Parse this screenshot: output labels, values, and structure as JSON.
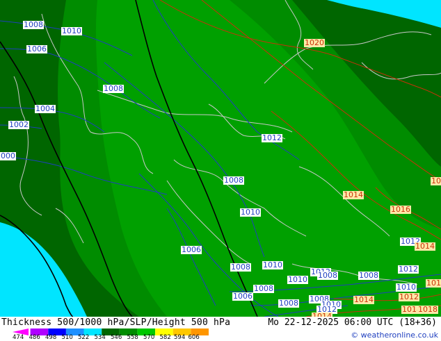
{
  "footer": {
    "title": "Thickness 500/1000 hPa/SLP/Height 500 hPa",
    "datetime": "Mo 22-12-2025 06:00 UTC (18+36)",
    "copyright": "© weatheronline.co.uk"
  },
  "scale": {
    "ticks": [
      "474",
      "486",
      "498",
      "510",
      "522",
      "534",
      "546",
      "558",
      "570",
      "582",
      "594",
      "606"
    ],
    "colors": [
      "#ff00ff",
      "#b000ff",
      "#0000ff",
      "#1e90ff",
      "#00e5ff",
      "#006600",
      "#008c00",
      "#00c800",
      "#ffff00",
      "#ffc800",
      "#ff9600"
    ]
  },
  "colors": {
    "thickness_cyan": "#00e5ff",
    "thickness_dark": "#006600",
    "thickness_mid": "#008c00",
    "thickness_light": "#00a000",
    "isobar_low": "#1f3fbf",
    "isobar_high": "#c8320a",
    "height_500": "#000000",
    "coastline": "#bfbfbf"
  },
  "isobar_labels": [
    {
      "text": "1008",
      "color": "blue"
    },
    {
      "text": "1010",
      "color": "blue"
    },
    {
      "text": "1006",
      "color": "blue"
    },
    {
      "text": "1008",
      "color": "blue"
    },
    {
      "text": "1004",
      "color": "blue"
    },
    {
      "text": "1002",
      "color": "blue"
    },
    {
      "text": "000",
      "color": "blue"
    },
    {
      "text": "1012",
      "color": "blue"
    },
    {
      "text": "1008",
      "color": "blue"
    },
    {
      "text": "1010",
      "color": "blue"
    },
    {
      "text": "1006",
      "color": "blue"
    },
    {
      "text": "1008",
      "color": "blue"
    },
    {
      "text": "1010",
      "color": "blue"
    },
    {
      "text": "1012",
      "color": "blue"
    },
    {
      "text": "1008",
      "color": "blue"
    },
    {
      "text": "1006",
      "color": "blue"
    },
    {
      "text": "1008",
      "color": "blue"
    },
    {
      "text": "1010",
      "color": "blue"
    },
    {
      "text": "1008",
      "color": "blue"
    },
    {
      "text": "1008",
      "color": "blue"
    },
    {
      "text": "1008",
      "color": "blue"
    },
    {
      "text": "1010",
      "color": "blue"
    },
    {
      "text": "1012",
      "color": "blue"
    },
    {
      "text": "1012",
      "color": "blue"
    },
    {
      "text": "1010",
      "color": "blue"
    },
    {
      "text": "1012",
      "color": "blue"
    },
    {
      "text": "1020",
      "color": "red"
    },
    {
      "text": "1014",
      "color": "red"
    },
    {
      "text": "1016",
      "color": "red"
    },
    {
      "text": "1014",
      "color": "red"
    },
    {
      "text": "1014",
      "color": "red"
    },
    {
      "text": "1012",
      "color": "red"
    },
    {
      "text": "1018",
      "color": "red"
    },
    {
      "text": "1018",
      "color": "red"
    },
    {
      "text": "101",
      "color": "red"
    },
    {
      "text": "101",
      "color": "red"
    },
    {
      "text": "1014",
      "color": "red"
    }
  ]
}
